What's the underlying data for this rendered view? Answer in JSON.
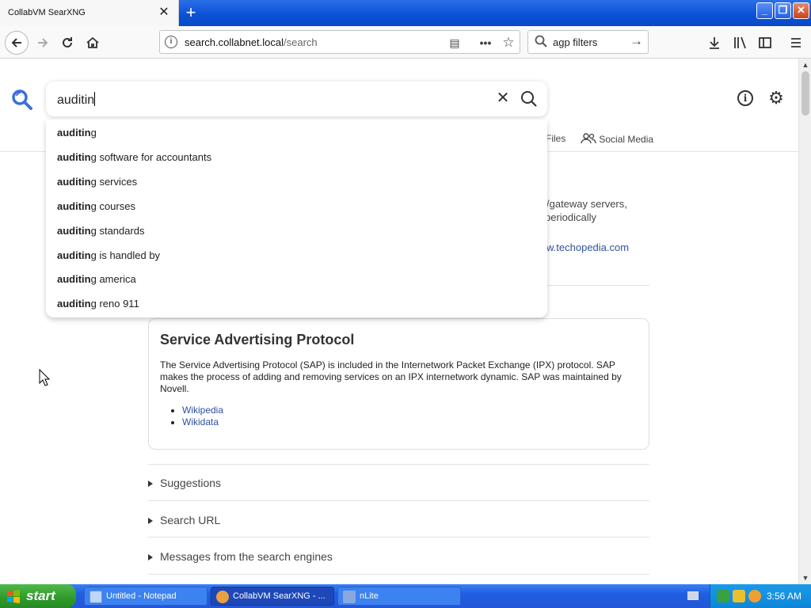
{
  "browser": {
    "tab_title": "CollabVM SearXNG",
    "tab_close": "✕",
    "new_tab": "+",
    "url_host": "search.collabnet.local",
    "url_path": "/search",
    "search_box_text": "agp filters"
  },
  "search": {
    "query": "auditin",
    "clear_symbol": "✕"
  },
  "categories": {
    "files": "Files",
    "social_media": "Social Media"
  },
  "answer_fragments": {
    "line1": "/gateway servers,",
    "line2": "periodically",
    "link": "w.techopedia.com"
  },
  "autocomplete": {
    "prefix": "auditin",
    "items": [
      {
        "suffix": "g"
      },
      {
        "suffix": "g software for accountants"
      },
      {
        "suffix": "g services"
      },
      {
        "suffix": "g courses"
      },
      {
        "suffix": "g standards"
      },
      {
        "suffix": "g is handled by"
      },
      {
        "suffix": "g america"
      },
      {
        "suffix": "g reno 911"
      }
    ]
  },
  "infobox": {
    "title": "Service Advertising Protocol",
    "description": "The Service Advertising Protocol (SAP) is included in the Internetwork Packet Exchange (IPX) protocol. SAP makes the process of adding and removing services on an IPX internetwork dynamic. SAP was maintained by Novell.",
    "links": [
      "Wikipedia",
      "Wikidata"
    ]
  },
  "sections": {
    "suggestions": "Suggestions",
    "search_url": "Search URL",
    "messages": "Messages from the search engines"
  },
  "taskbar": {
    "start": "start",
    "tasks": [
      "Untitled - Notepad",
      "CollabVM SearXNG - ...",
      "nLite"
    ],
    "clock": "3:56 AM"
  },
  "colors": {
    "accent": "#3050a0",
    "search_icon": "#3b6fd8",
    "titlebar": "#0a50d6",
    "start_green": "#2e9a2a"
  }
}
